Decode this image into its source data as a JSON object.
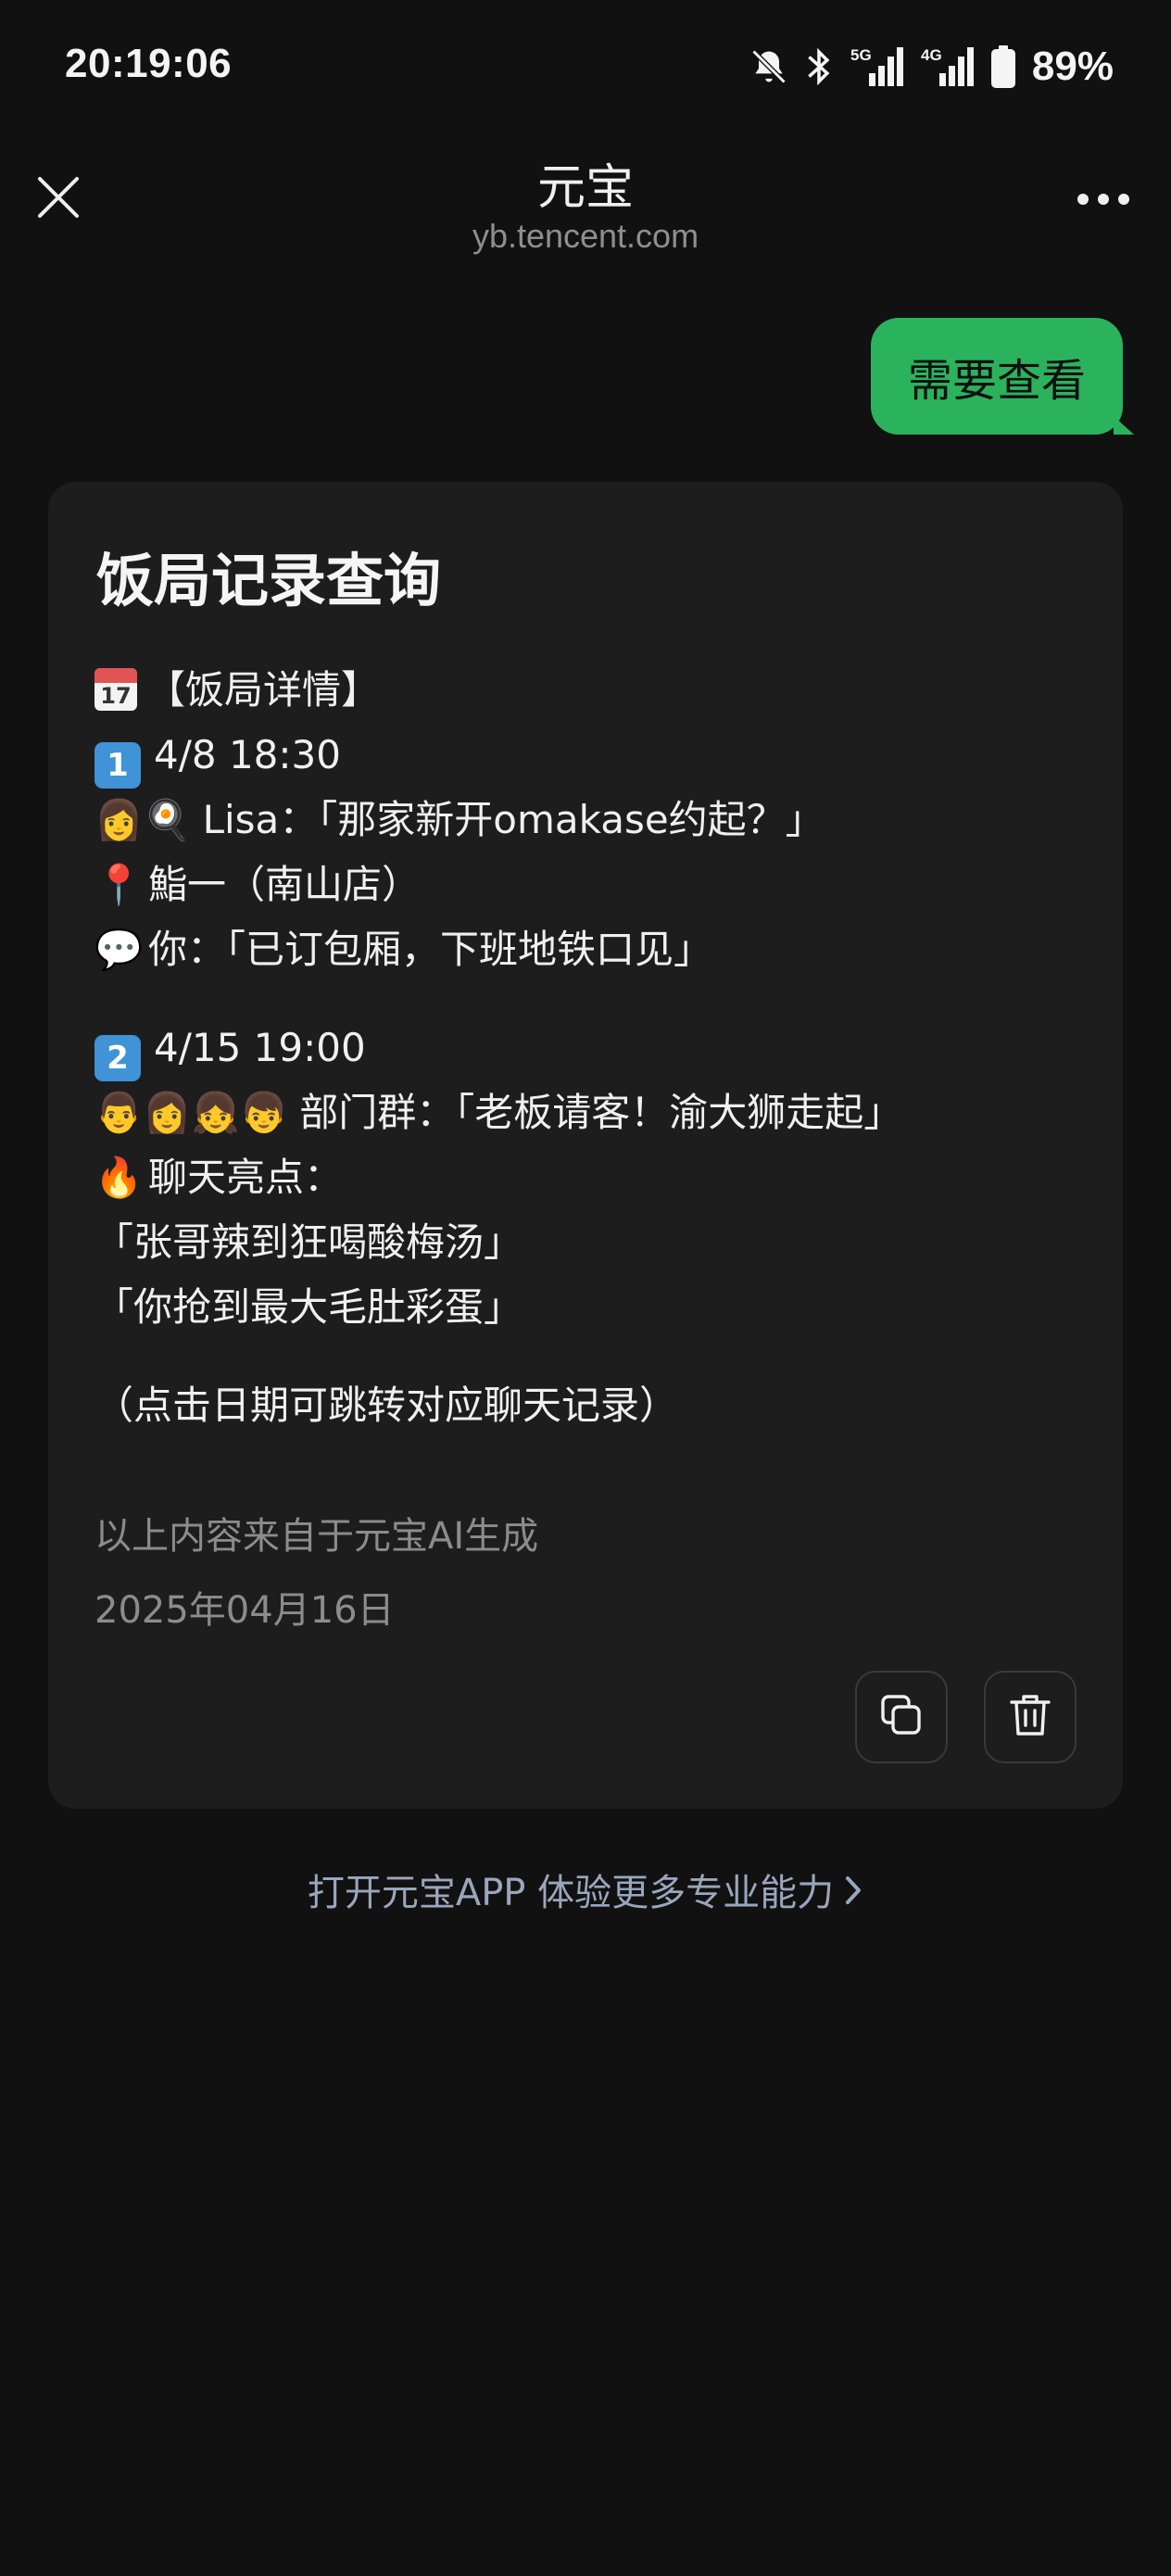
{
  "status_bar": {
    "time": "20:19:06",
    "icons": [
      "bell-off-icon",
      "bluetooth-icon",
      "signal-5g-icon",
      "signal-4g-icon",
      "battery-icon"
    ],
    "network_1": "5G",
    "network_2": "4G",
    "battery": "89%",
    "battery_level": 0.89
  },
  "header": {
    "title": "元宝",
    "subtitle": "yb.tencent.com",
    "close_icon": "close-icon",
    "more_icon": "more-horizontal-icon"
  },
  "chat": {
    "user_message": "需要查看",
    "user_bubble_color": "#2bb25d"
  },
  "card": {
    "title": "饭局记录查询",
    "section_header": "【饭局详情】",
    "section_header_icon": "calendar-icon",
    "calendar_icon_text": "17",
    "entries": [
      {
        "number": "1",
        "datetime": "4/8 18:30",
        "people_text": "Lisa：「那家新开omakase约起？」",
        "people_icon": "woman-cook-emoji",
        "location_icon": "pin-emoji",
        "location": "鮨一（南山店）",
        "reply_icon": "speech-bubble-emoji",
        "reply": "你：「已订包厢，下班地铁口见」"
      },
      {
        "number": "2",
        "datetime": "4/15 19:00",
        "group_icon": "family-emoji",
        "group_text": "部门群：「老板请客！渝大狮走起」",
        "highlight_icon": "fire-emoji",
        "highlight_label": "聊天亮点：",
        "highlights": [
          "「张哥辣到狂喝酸梅汤」",
          "「你抢到最大毛肚彩蛋」"
        ]
      }
    ],
    "hint": "（点击日期可跳转对应聊天记录）",
    "footnote": "以上内容来自于元宝AI生成",
    "date": "2025年04月16日",
    "copy_icon": "copy-icon",
    "delete_icon": "trash-icon"
  },
  "footer": {
    "open_app": "打开元宝APP 体验更多专业能力",
    "open_app_icon": "chevron-right-icon",
    "link_color": "#9aa6bd"
  }
}
